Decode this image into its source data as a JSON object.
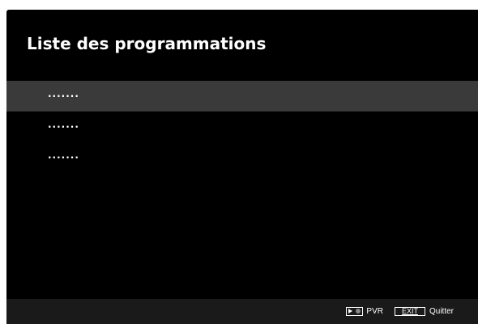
{
  "header": {
    "title": "Liste des programmations"
  },
  "schedule_list": {
    "selected_index": 0,
    "items": [
      {
        "label": "......."
      },
      {
        "label": "......."
      },
      {
        "label": "......."
      }
    ]
  },
  "footer": {
    "pvr": {
      "icon": "play-record-key-icon",
      "label": "PVR"
    },
    "exit": {
      "key_label": "EXIT",
      "label": "Quitter"
    }
  },
  "colors": {
    "screen_background": "#000000",
    "selected_row": "#3a3a3a",
    "footer_background": "#1a1a1a",
    "text": "#ffffff"
  }
}
